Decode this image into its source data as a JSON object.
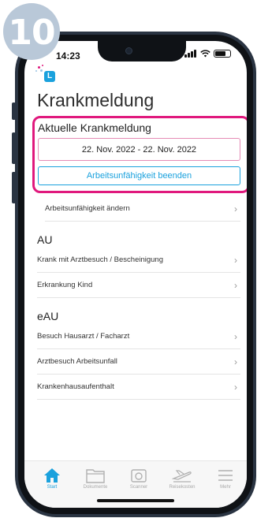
{
  "step_badge": "10",
  "status": {
    "time": "14:23"
  },
  "logo": {
    "letter": "L"
  },
  "page": {
    "title": "Krankmeldung"
  },
  "current": {
    "title": "Aktuelle Krankmeldung",
    "date_range": "22. Nov. 2022 - 22. Nov. 2022",
    "end_button": "Arbeitsunfähigkeit beenden",
    "change_row": "Arbeitsunfähigkeit ändern"
  },
  "sections": [
    {
      "title": "AU",
      "items": [
        "Krank mit Arztbesuch / Bescheinigung",
        "Erkrankung Kind"
      ]
    },
    {
      "title": "eAU",
      "items": [
        "Besuch Hausarzt / Facharzt",
        "Arztbesuch Arbeitsunfall",
        "Krankenhausaufenthalt"
      ]
    }
  ],
  "tabs": [
    {
      "label": "Start",
      "icon": "home-icon",
      "active": true
    },
    {
      "label": "Dokumente",
      "icon": "folder-icon",
      "active": false
    },
    {
      "label": "Scanner",
      "icon": "camera-icon",
      "active": false
    },
    {
      "label": "Reisekosten",
      "icon": "plane-icon",
      "active": false
    },
    {
      "label": "Mehr",
      "icon": "menu-icon",
      "active": false
    }
  ],
  "colors": {
    "accent": "#1aa1dd",
    "highlight": "#e0197d",
    "badge": "#b9c8d8"
  }
}
